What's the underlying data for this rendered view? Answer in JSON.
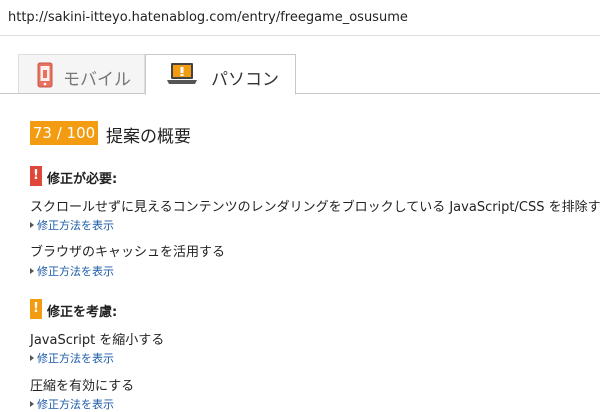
{
  "browser": {
    "url": "http://sakini-itteyo.hatenablog.com/entry/freegame_osusume"
  },
  "tabs": [
    {
      "label": "モバイル",
      "icon": "mobile-phone-icon",
      "selected": false
    },
    {
      "label": "パソコン",
      "icon": "laptop-icon",
      "selected": true
    }
  ],
  "summary": {
    "score": "73 / 100",
    "title": "提案の概要"
  },
  "sections": [
    {
      "heading": "修正が必要:",
      "flag": "!",
      "color": "#e0473b",
      "rules": [
        {
          "text": "スクロールせずに見えるコンテンツのレンダリングをブロックしている JavaScript/CSS を排除する",
          "link": "修正方法を表示"
        },
        {
          "text": "ブラウザのキャッシュを活用する",
          "link": "修正方法を表示"
        }
      ]
    },
    {
      "heading": "修正を考慮:",
      "flag": "!",
      "color": "#f39c12",
      "rules": [
        {
          "text": "JavaScript を縮小する",
          "link": "修正方法を表示"
        },
        {
          "text": "圧縮を有効にする",
          "link": "修正方法を表示"
        }
      ]
    }
  ],
  "colors": {
    "score_badge": "#f39c12",
    "must_fix": "#e0473b",
    "consider_fix": "#f39c12",
    "link": "#1a5aa8"
  }
}
